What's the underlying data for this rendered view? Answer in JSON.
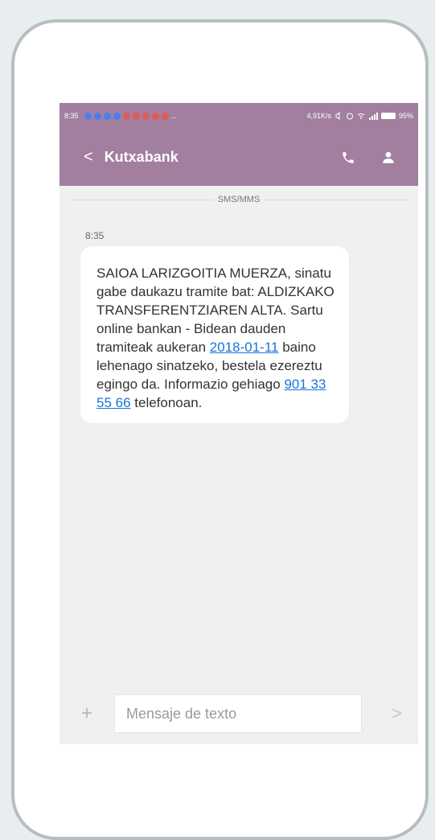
{
  "status_bar": {
    "time": "8:35",
    "speed": "4,91K/s",
    "battery": "95%",
    "notif_colors": [
      "#4a7ef0",
      "#4a7ef0",
      "#4a7ef0",
      "#4a7ef0",
      "#e05a5a",
      "#e05a5a",
      "#e05a5a",
      "#e05a5a",
      "#e05a5a"
    ],
    "ellipsis": "..."
  },
  "header": {
    "back_glyph": "<",
    "title": "Kutxabank",
    "accent_color": "#a27f9f"
  },
  "conversation": {
    "divider_label": "SMS/MMS",
    "message_time": "8:35",
    "message": {
      "text_before_link1": "SAIOA LARIZGOITIA MUERZA, sinatu gabe daukazu tramite bat: ALDIZKAKO TRANSFERENTZIAREN ALTA. Sartu online bankan - Bidean dauden tramiteak aukeran ",
      "link1": "2018-01-11",
      "text_between": " baino lehenago sinatzeko, bestela ezereztu egingo da. Informazio gehiago ",
      "link2": "901 33 55 66",
      "text_after": " telefonoan."
    }
  },
  "composer": {
    "plus_glyph": "+",
    "placeholder": "Mensaje de texto",
    "send_glyph": ">"
  }
}
